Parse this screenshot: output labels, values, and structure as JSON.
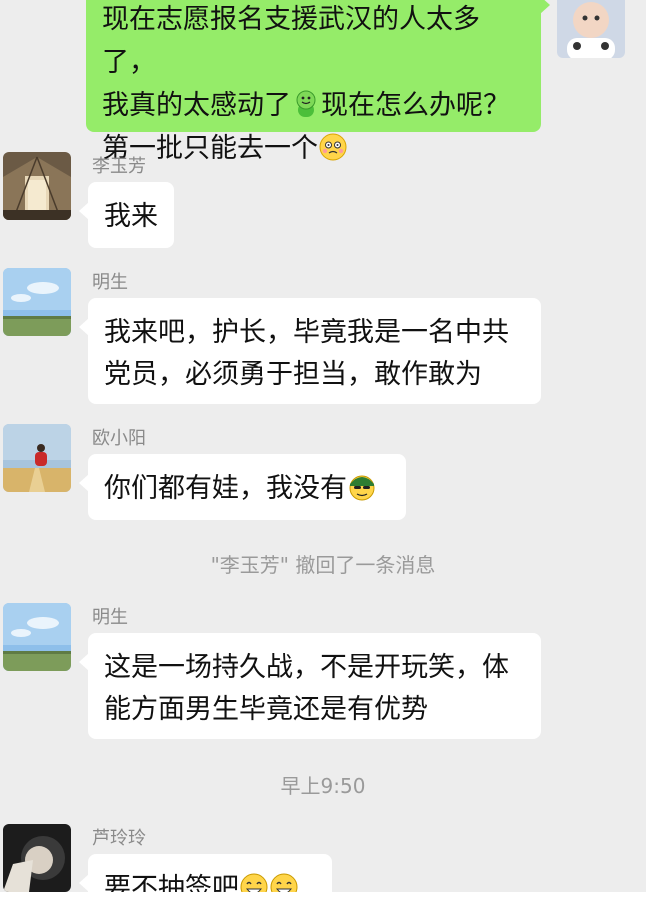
{
  "messages": {
    "m1": {
      "line1": "现在志愿报名支援武汉的人太多了，",
      "line2a": "我真的太感动了",
      "emoji_a": "smile-emoji",
      "line2b": "现在怎么办呢？",
      "line3": "第一批只能去一个",
      "emoji_b": "awkward-emoji"
    },
    "m2": {
      "sender": "李玉芳",
      "text": "我来"
    },
    "m3": {
      "sender": "明生",
      "line1": "我来吧，护长，毕竟我是一名中共",
      "line2": "党员，必须勇于担当，敢作敢为"
    },
    "m4": {
      "sender": "欧小阳",
      "text": "你们都有娃，我没有",
      "emoji": "smug-emoji"
    },
    "recall_notice": "\"李玉芳\" 撤回了一条消息",
    "m5": {
      "sender": "明生",
      "line1": "这是一场持久战，不是开玩笑，体",
      "line2": "能方面男生毕竟还是有优势"
    },
    "timestamp": "早上9:50",
    "m6": {
      "sender": "芦玲玲",
      "text": "要不抽签吧",
      "emoji": "grin-emoji"
    }
  },
  "colors": {
    "background": "#ededed",
    "my_bubble": "#95ec69",
    "other_bubble": "#ffffff",
    "meta_text": "#9a9a9a"
  }
}
